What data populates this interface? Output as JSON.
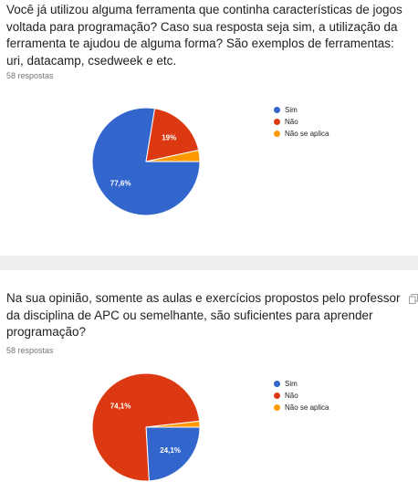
{
  "charts": [
    {
      "question": "Você já utilizou alguma ferramenta que continha características de jogos voltada para programação? Caso sua resposta seja sim, a utilização da ferramenta te ajudou de alguma forma? São exemplos de ferramentas: uri, datacamp, csedweek e etc.",
      "responses": "58 respostas"
    },
    {
      "question": "Na sua opinião, somente as aulas e exercícios propostos pelo professor da disciplina de APC ou semelhante, são suficientes para aprender programação?",
      "responses": "58 respostas"
    }
  ],
  "chart_data": [
    {
      "type": "pie",
      "labels": [
        "Sim",
        "Não",
        "Não se aplica"
      ],
      "values": [
        77.6,
        19.0,
        3.4
      ],
      "data_labels": [
        "77,6%",
        "19%",
        ""
      ],
      "colors": [
        "#3366cc",
        "#dc3912",
        "#ff9900"
      ],
      "legend": "right"
    },
    {
      "type": "pie",
      "labels": [
        "Sim",
        "Não",
        "Não se aplica"
      ],
      "values": [
        24.1,
        74.1,
        1.8
      ],
      "data_labels": [
        "24,1%",
        "74,1%",
        ""
      ],
      "colors": [
        "#3366cc",
        "#dc3912",
        "#ff9900"
      ],
      "legend": "right"
    }
  ]
}
